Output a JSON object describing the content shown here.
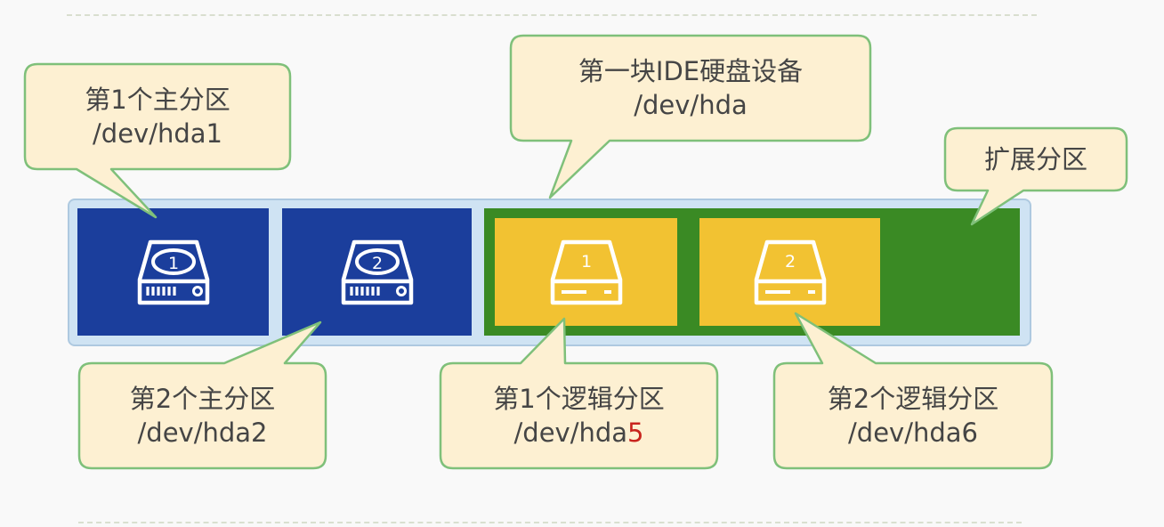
{
  "callouts": {
    "primary1": {
      "line1": "第1个主分区",
      "line2": "/dev/hda1"
    },
    "primary2": {
      "line1": "第2个主分区",
      "line2": "/dev/hda2"
    },
    "device": {
      "line1": "第一块IDE硬盘设备",
      "line2": "/dev/hda"
    },
    "extended": {
      "line1": "扩展分区"
    },
    "logical1": {
      "line1": "第1个逻辑分区",
      "line2_prefix": "/dev/hda",
      "line2_highlight": "5"
    },
    "logical2": {
      "line1": "第2个逻辑分区",
      "line2": "/dev/hda6"
    }
  },
  "partitions": {
    "primary1": {
      "badge": "1"
    },
    "primary2": {
      "badge": "2"
    },
    "logical1": {
      "badge": "1"
    },
    "logical2": {
      "badge": "2"
    }
  },
  "colors": {
    "primary_partition": "#1b3e9c",
    "extended_partition": "#3a8a24",
    "logical_partition": "#f2c232",
    "callout_fill": "#fdf0d2",
    "callout_border": "#7fc07a",
    "highlight_text": "#c8231d"
  },
  "icons": {
    "drive": "hard-drive-icon"
  }
}
